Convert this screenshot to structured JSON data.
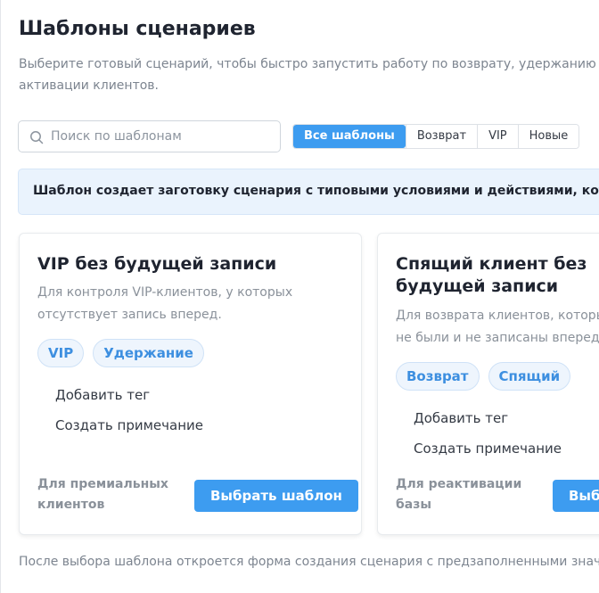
{
  "modal": {
    "title": "Шаблоны сценариев",
    "subtitle": "Выберите готовый сценарий, чтобы быстро запустить работу по возврату, удержанию и активации клиентов.",
    "footer_note": "После выбора шаблона откроется форма создания сценария с предзаполненными значениями."
  },
  "search": {
    "placeholder": "Поиск по шаблонам",
    "icon": "search-icon"
  },
  "filters": [
    {
      "label": "Все шаблоны",
      "active": true
    },
    {
      "label": "Возврат",
      "active": false
    },
    {
      "label": "VIP",
      "active": false
    },
    {
      "label": "Новые",
      "active": false
    }
  ],
  "banner": {
    "text": "Шаблон создает заготовку сценария с типовыми условиями и действиями, которые можно изменить."
  },
  "cards": [
    {
      "title": "VIP без будущей записи",
      "description": "Для контроля VIP-клиентов, у которых отсутствует запись вперед.",
      "tags": [
        "VIP",
        "Удержание"
      ],
      "actions": [
        "Добавить тег",
        "Создать примечание"
      ],
      "footer": "Для премиальных клиентов",
      "button": "Выбрать шаблон"
    },
    {
      "title": "Спящий клиент без будущей записи",
      "description": "Для возврата клиентов, которые давно не были и не записаны вперед.",
      "tags": [
        "Возврат",
        "Спящий"
      ],
      "actions": [
        "Добавить тег",
        "Создать примечание"
      ],
      "footer": "Для реактивации базы",
      "button": "Выбрать шаблон"
    }
  ],
  "colors": {
    "accent": "#3d9cf0",
    "banner_bg": "#eaf3fd",
    "tag_bg": "#eef5fd",
    "tag_text": "#3d8fe0",
    "muted": "#8a919a"
  }
}
